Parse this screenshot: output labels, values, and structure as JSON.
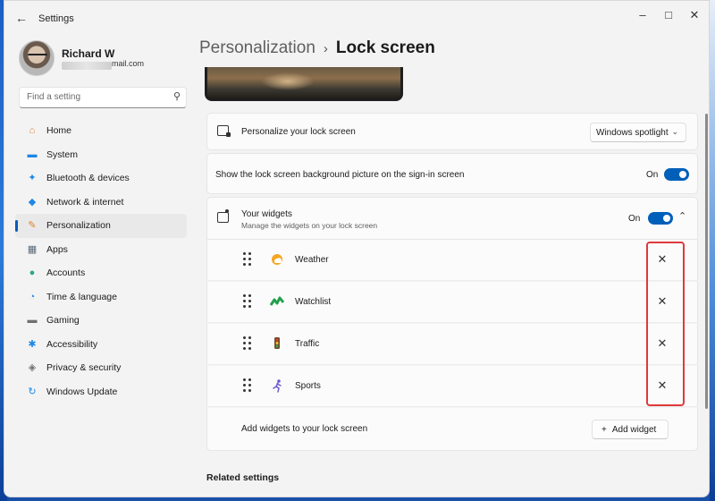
{
  "window": {
    "app_title": "Settings",
    "minimize": "–",
    "maximize": "□",
    "close": "✕"
  },
  "user": {
    "name": "Richard W",
    "email_visible": "mail.com"
  },
  "search": {
    "placeholder": "Find a setting"
  },
  "sidebar": {
    "items": [
      {
        "label": "Home",
        "icon": "home-icon",
        "glyph": "⌂",
        "color": "#e3823b",
        "active": false
      },
      {
        "label": "System",
        "icon": "system-icon",
        "glyph": "▬",
        "color": "#1e88e5",
        "active": false
      },
      {
        "label": "Bluetooth & devices",
        "icon": "bluetooth-icon",
        "glyph": "✦",
        "color": "#1e88e5",
        "active": false
      },
      {
        "label": "Network & internet",
        "icon": "network-icon",
        "glyph": "◆",
        "color": "#1e88e5",
        "active": false
      },
      {
        "label": "Personalization",
        "icon": "brush-icon",
        "glyph": "✎",
        "color": "#d9822b",
        "active": true
      },
      {
        "label": "Apps",
        "icon": "apps-icon",
        "glyph": "▦",
        "color": "#5a6b7a",
        "active": false
      },
      {
        "label": "Accounts",
        "icon": "accounts-icon",
        "glyph": "●",
        "color": "#2fa58a",
        "active": false
      },
      {
        "label": "Time & language",
        "icon": "time-language-icon",
        "glyph": "◔",
        "color": "#1e88e5",
        "active": false
      },
      {
        "label": "Gaming",
        "icon": "gaming-icon",
        "glyph": "▬",
        "color": "#6f6f6f",
        "active": false
      },
      {
        "label": "Accessibility",
        "icon": "accessibility-icon",
        "glyph": "✱",
        "color": "#1e88e5",
        "active": false
      },
      {
        "label": "Privacy & security",
        "icon": "shield-icon",
        "glyph": "◈",
        "color": "#6f6f6f",
        "active": false
      },
      {
        "label": "Windows Update",
        "icon": "windows-update-icon",
        "glyph": "↻",
        "color": "#1e88e5",
        "active": false
      }
    ]
  },
  "breadcrumb": {
    "parent": "Personalization",
    "separator": "›",
    "current": "Lock screen"
  },
  "lock_screen": {
    "personalize_label": "Personalize your lock screen",
    "personalize_value": "Windows spotlight",
    "signin_label": "Show the lock screen background picture on the sign-in screen",
    "signin_state": "On",
    "widgets_title": "Your widgets",
    "widgets_subtitle": "Manage the widgets on your lock screen",
    "widgets_state": "On",
    "widgets": [
      {
        "label": "Weather",
        "icon": "weather-icon"
      },
      {
        "label": "Watchlist",
        "icon": "watchlist-icon"
      },
      {
        "label": "Traffic",
        "icon": "traffic-icon"
      },
      {
        "label": "Sports",
        "icon": "sports-icon"
      }
    ],
    "add_label": "Add widgets to your lock screen",
    "add_button": "Add widget"
  },
  "related": {
    "title": "Related settings"
  },
  "colors": {
    "accent": "#005fb8",
    "highlight": "#e0393b"
  }
}
